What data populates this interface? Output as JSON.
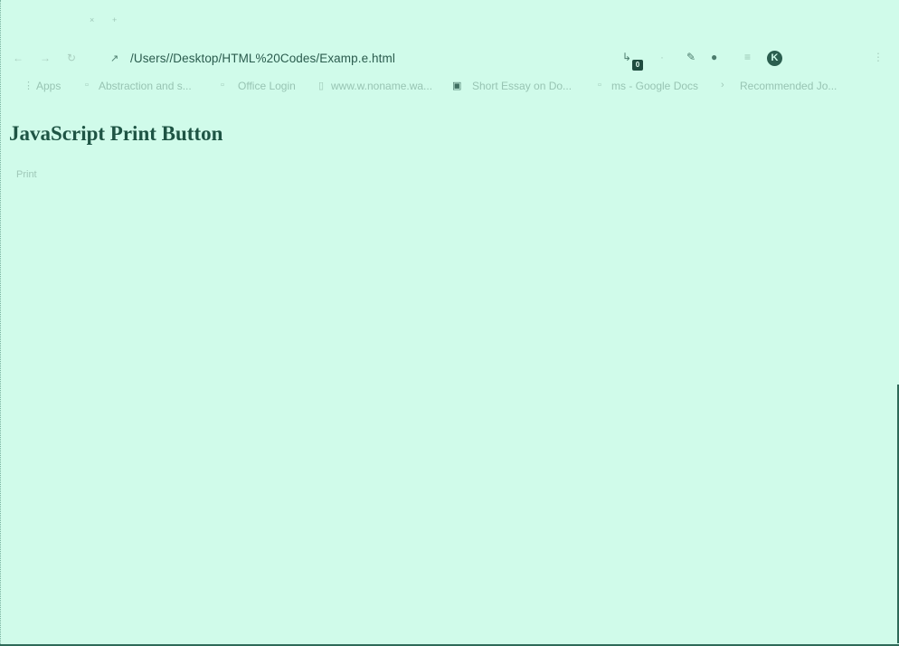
{
  "browser": {
    "address_bar": {
      "url": "/Users//Desktop/HTML%20Codes/Examp.e.html"
    },
    "extensions": {
      "badge_count": "0",
      "profile_initial": "K"
    },
    "bookmarks": [
      {
        "label": "Apps",
        "icon": "apps-grid-icon"
      },
      {
        "label": "Abstraction and s...",
        "icon": "page-icon"
      },
      {
        "label": "Office Login",
        "icon": "page-icon"
      },
      {
        "label": "www.w.noname.wa...",
        "icon": "page-icon"
      },
      {
        "label": "Short Essay on Do...",
        "icon": "image-icon"
      },
      {
        "label": "ms - Google Docs",
        "icon": "docs-icon"
      },
      {
        "label": "Recommended Jo...",
        "icon": "page-icon"
      }
    ]
  },
  "page": {
    "title": "JavaScript Print Button",
    "print_button_label": "Print"
  },
  "colors": {
    "background": "#d0fbea",
    "text": "#1e5444",
    "muted": "#9fc8b8"
  }
}
